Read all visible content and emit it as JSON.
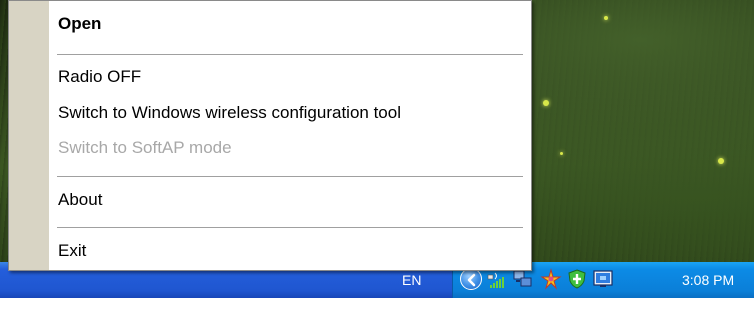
{
  "menu": {
    "items": [
      {
        "label": "Open",
        "bold": true,
        "enabled": true
      },
      {
        "label": "Radio OFF",
        "enabled": true
      },
      {
        "label": "Switch to Windows wireless configuration tool",
        "enabled": true
      },
      {
        "label": "Switch to SoftAP mode",
        "enabled": false
      },
      {
        "label": "About",
        "enabled": true
      },
      {
        "label": "Exit",
        "enabled": true
      }
    ]
  },
  "taskbar": {
    "language": "EN",
    "tray_icons": [
      "show-hidden-icons",
      "wireless-signal-icon",
      "network-computers-icon",
      "star-app-icon",
      "shield-icon",
      "monitor-icon"
    ],
    "clock": "3:08 PM"
  },
  "colors": {
    "menu_gutter": "#d8d4c4",
    "disabled_text": "#a8a8a8",
    "taskbar_blue": "#245edb",
    "tray_blue": "#0c8be6"
  }
}
